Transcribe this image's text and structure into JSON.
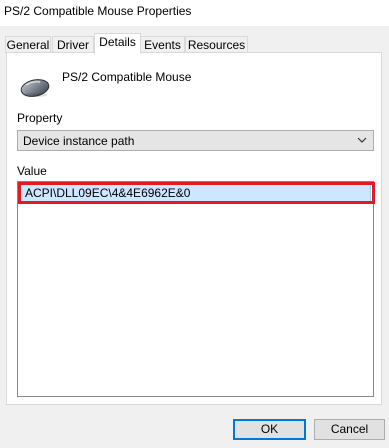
{
  "window": {
    "title": "PS/2 Compatible Mouse Properties"
  },
  "tabs": [
    {
      "label": "General",
      "active": false
    },
    {
      "label": "Driver",
      "active": false
    },
    {
      "label": "Details",
      "active": true
    },
    {
      "label": "Events",
      "active": false
    },
    {
      "label": "Resources",
      "active": false
    }
  ],
  "device": {
    "icon": "mouse-icon",
    "name": "PS/2 Compatible Mouse"
  },
  "property": {
    "label": "Property",
    "selected": "Device instance path"
  },
  "value": {
    "label": "Value",
    "items": [
      "ACPI\\DLL09EC\\4&4E6962E&0"
    ]
  },
  "buttons": {
    "ok": "OK",
    "cancel": "Cancel"
  },
  "colors": {
    "highlight_border": "#e01b24",
    "selection_fill": "#cce8ff",
    "default_button_border": "#0078d7"
  }
}
